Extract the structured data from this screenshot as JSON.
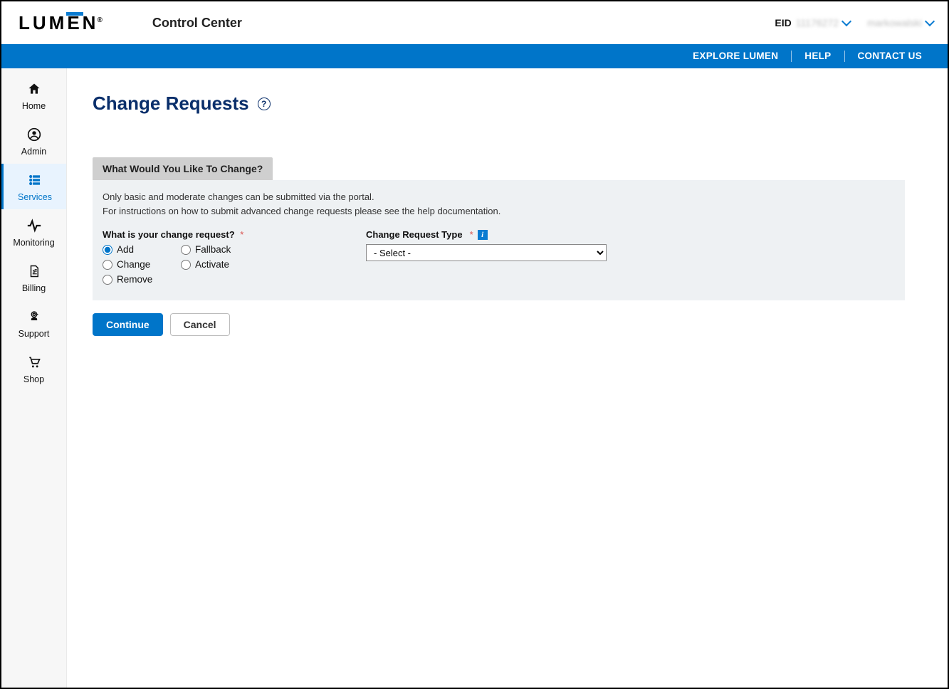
{
  "header": {
    "logo_text": "LUM",
    "logo_accent": "E",
    "logo_tail": "N",
    "app_title": "Control Center",
    "eid_label": "EID",
    "eid_value": "11176272",
    "username": "markowalski"
  },
  "bluenav": {
    "explore": "EXPLORE LUMEN",
    "help": "HELP",
    "contact": "CONTACT US"
  },
  "sidebar": {
    "items": [
      {
        "label": "Home"
      },
      {
        "label": "Admin"
      },
      {
        "label": "Services"
      },
      {
        "label": "Monitoring"
      },
      {
        "label": "Billing"
      },
      {
        "label": "Support"
      },
      {
        "label": "Shop"
      }
    ]
  },
  "page": {
    "title": "Change Requests",
    "help_glyph": "?"
  },
  "form": {
    "tab_header": "What Would You Like To Change?",
    "hint_line1": "Only basic and moderate changes can be submitted via the portal.",
    "hint_line2": "For instructions on how to submit advanced change requests please see the help documentation.",
    "radio_label": "What is your change request?",
    "required_mark": "*",
    "radios": {
      "add": "Add",
      "fallback": "Fallback",
      "change": "Change",
      "activate": "Activate",
      "remove": "Remove"
    },
    "selected_radio": "add",
    "type_label": "Change Request Type",
    "info_glyph": "i",
    "select_placeholder": "- Select -"
  },
  "actions": {
    "continue": "Continue",
    "cancel": "Cancel"
  }
}
